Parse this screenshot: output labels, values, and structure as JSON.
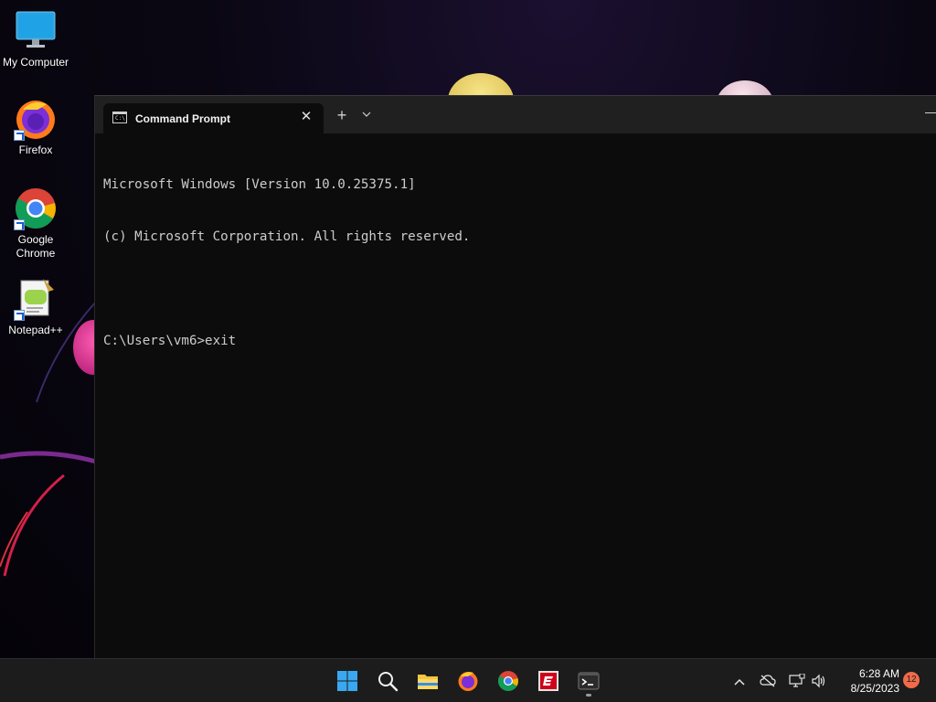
{
  "desktop": {
    "icons": [
      {
        "label": "My Computer",
        "icon": "monitor-icon"
      },
      {
        "label": "Firefox",
        "icon": "firefox-icon"
      },
      {
        "label": "Google Chrome",
        "icon": "chrome-icon"
      },
      {
        "label": "Notepad++",
        "icon": "notepad-plus-plus-icon"
      }
    ]
  },
  "terminal": {
    "tab_title": "Command Prompt",
    "tab_icon": "cmd-icon",
    "close_glyph": "✕",
    "new_tab_glyph": "+",
    "menu_glyph": "⌄",
    "lines": [
      "Microsoft Windows [Version 10.0.25375.1]",
      "(c) Microsoft Corporation. All rights reserved.",
      "",
      "C:\\Users\\vm6>exit"
    ],
    "background": "#0c0c0c",
    "text_color": "#cccccc"
  },
  "taskbar": {
    "items": [
      {
        "icon": "windows-start-icon"
      },
      {
        "icon": "search-icon"
      },
      {
        "icon": "file-explorer-icon"
      },
      {
        "icon": "firefox-icon"
      },
      {
        "icon": "chrome-icon"
      },
      {
        "icon": "espn-icon"
      },
      {
        "icon": "terminal-icon",
        "running": true
      }
    ],
    "tray": {
      "chevron": "^",
      "clock_time": "6:28 AM",
      "clock_date": "8/25/2023",
      "notification_count": "12"
    }
  }
}
